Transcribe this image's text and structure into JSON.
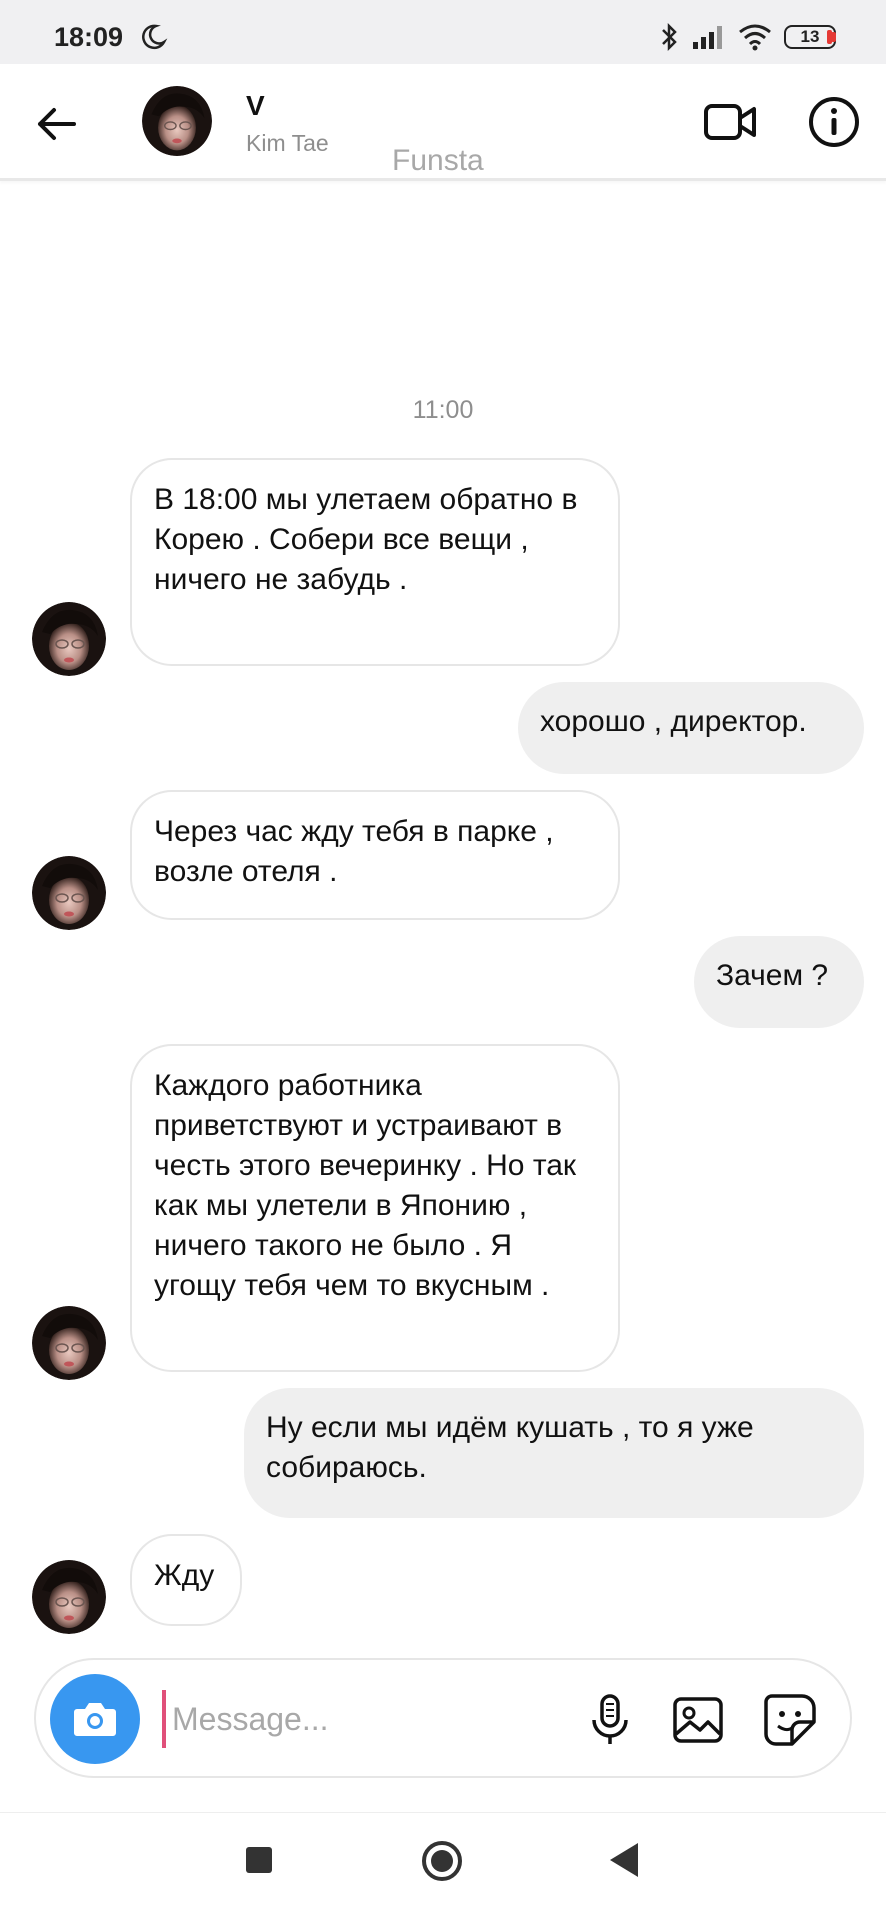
{
  "status_bar": {
    "time": "18:09",
    "battery": "13"
  },
  "header": {
    "title": "V",
    "subtitle": "Kim Tae",
    "watermark": "Funsta"
  },
  "thread": {
    "timestamp": "11:00",
    "messages": [
      {
        "from": "them",
        "text": "В 18:00 мы улетаем обратно  в Корею . Собери все вещи , ничего не забудь ."
      },
      {
        "from": "me",
        "text": "хорошо , директор."
      },
      {
        "from": "them",
        "text": "Через час жду тебя в парке , возле отеля ."
      },
      {
        "from": "me",
        "text": "Зачем ?"
      },
      {
        "from": "them",
        "text": "Каждого работника приветствуют и устраивают в честь этого вечеринку . Но так как мы улетели в Японию , ничего такого не было . Я угощу тебя чем то вкусным ."
      },
      {
        "from": "me",
        "text": "Ну если  мы идём кушать , то я уже собираюсь."
      },
      {
        "from": "them",
        "text": "Жду"
      }
    ]
  },
  "composer": {
    "placeholder": "Message..."
  },
  "colors": {
    "accent": "#3897f0",
    "outgoing_bubble": "#efefef",
    "incoming_border": "#e6e6e6",
    "muted_text": "#8e8e8e"
  },
  "icons": [
    "back-arrow-icon",
    "video-camera-icon",
    "info-icon",
    "camera-icon",
    "microphone-icon",
    "gallery-icon",
    "sticker-icon",
    "moon-icon",
    "bluetooth-icon",
    "signal-icon",
    "wifi-icon",
    "battery-icon"
  ]
}
